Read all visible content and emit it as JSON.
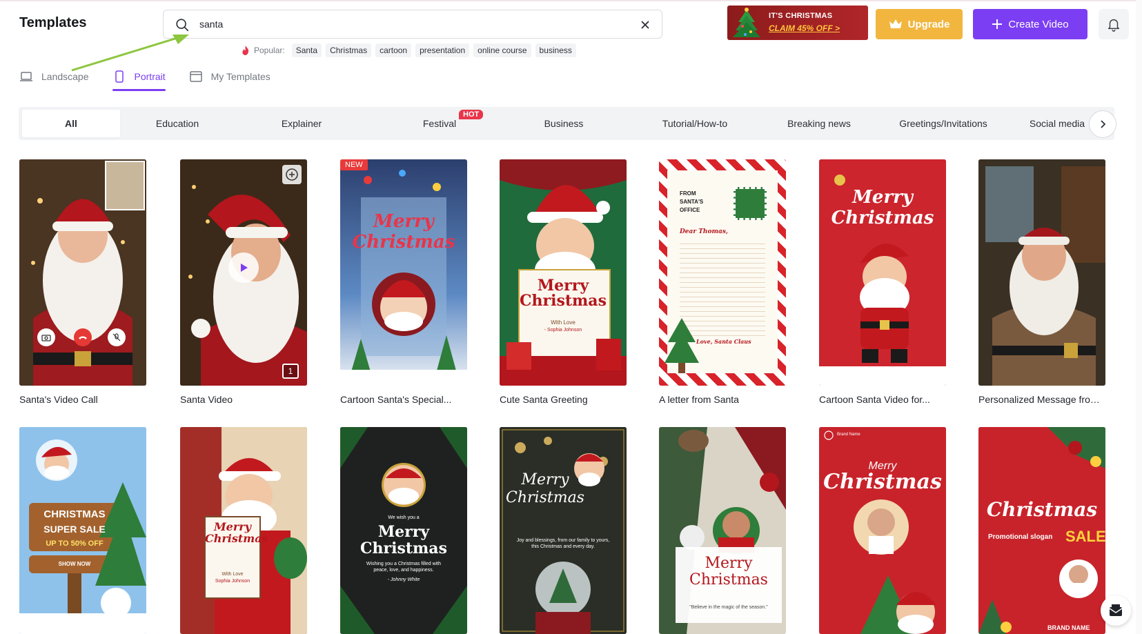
{
  "header": {
    "title": "Templates",
    "search_value": "santa",
    "popular_label": "Popular:",
    "popular_tags": [
      "Santa",
      "Christmas",
      "cartoon",
      "presentation",
      "online course",
      "business"
    ],
    "promo_line1": "IT'S CHRISTMAS",
    "promo_line2": "CLAIM 45% OFF >",
    "upgrade_label": "Upgrade",
    "create_label": "Create Video"
  },
  "orientation_tabs": [
    {
      "label": "Landscape",
      "icon": "laptop-icon"
    },
    {
      "label": "Portrait",
      "icon": "phone-icon",
      "active": true
    },
    {
      "label": "My Templates",
      "icon": "folder-icon"
    }
  ],
  "categories": [
    "All",
    "Education",
    "Explainer",
    "Festival",
    "Business",
    "Tutorial/How-to",
    "Breaking news",
    "Greetings/Invitations",
    "Social media"
  ],
  "hot_badge": "HOT",
  "cards_row1": [
    {
      "name": "Santa's Video Call"
    },
    {
      "name": "Santa Video",
      "count": "1"
    },
    {
      "name": "Cartoon Santa's Special...",
      "badge": "NEW",
      "title": "Merry Christmas"
    },
    {
      "name": "Cute Santa Greeting",
      "title": "Merry Christmas",
      "sub": "With Love",
      "sub2": "- Sophia Johnson"
    },
    {
      "name": "A letter from Santa",
      "from": "FROM SANTA'S OFFICE",
      "dear": "Dear Thomas,",
      "love": "Love, Santa Claus"
    },
    {
      "name": "Cartoon Santa Video for...",
      "title": "Merry Christmas"
    },
    {
      "name": "Personalized Message from..."
    }
  ],
  "cards_row2": [
    {
      "sign1": "CHRISTMAS",
      "sign2": "SUPER SALE",
      "sign3": "UP TO 50% OFF",
      "sign4": "SHOW NOW"
    },
    {
      "title": "Merry Christmas",
      "sub": "With Love",
      "sub2": "Sophia Johnson"
    },
    {
      "pre": "We wish you a",
      "title": "Merry Christmas",
      "sub": "Wishing you a Christmas filled with peace, love, and happiness.",
      "sign": "- Johnny White"
    },
    {
      "title": "Merry Christmas",
      "sub": "Joy and blessings, from our family to yours, this Christmas and every day."
    },
    {
      "title": "Merry Christmas",
      "quote": "\"Believe in the magic of the season.\""
    },
    {
      "brand": "Brand Name",
      "title1": "Merry",
      "title2": "Christmas"
    },
    {
      "title": "Christmas",
      "slogan": "Promotional slogan",
      "sale": "SALE",
      "brand": "BRAND NAME"
    }
  ]
}
